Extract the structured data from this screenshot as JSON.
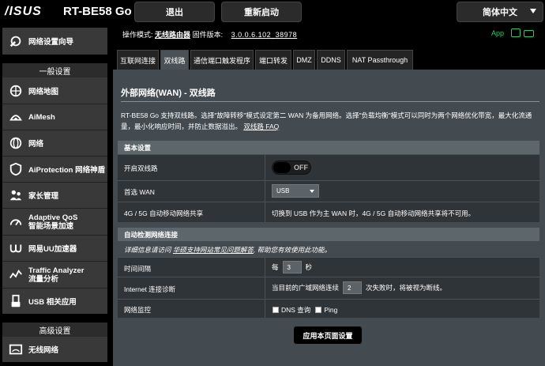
{
  "header": {
    "brand": "/ISUS",
    "model": "RT-BE58 Go",
    "logout_label": "退出",
    "reboot_label": "重新启动",
    "language": "简体中文"
  },
  "status": {
    "mode_label": "操作模式:",
    "mode_value": "无线路由器",
    "fw_label": "固件版本:",
    "fw_value": "3.0.0.6.102_38978",
    "app_label": "App"
  },
  "sidebar": {
    "quick_setup": "网络设置向导",
    "general_header": "一般设置",
    "items": [
      {
        "label": "网络地图",
        "icon": "network-map-icon"
      },
      {
        "label": "AiMesh",
        "icon": "aimesh-icon"
      },
      {
        "label": "网络",
        "icon": "globe-icon"
      },
      {
        "label": "AiProtection 网络神盾",
        "icon": "shield-icon"
      },
      {
        "label": "家长管理",
        "icon": "family-icon"
      },
      {
        "label": "Adaptive QoS",
        "label2": "智能场景加速",
        "icon": "qos-icon"
      },
      {
        "label": "网易UU加速器",
        "icon": "uu-icon"
      },
      {
        "label": "Traffic Analyzer",
        "label2": "流量分析",
        "icon": "traffic-icon"
      },
      {
        "label": "USB 相关应用",
        "icon": "usb-icon"
      }
    ],
    "advanced_header": "高级设置",
    "advanced_items": [
      {
        "label": "无线网络",
        "icon": "wifi-icon"
      }
    ]
  },
  "tabs": [
    "互联网连接",
    "双线路",
    "通信端口触发程序",
    "端口转发",
    "DMZ",
    "DDNS",
    "NAT Passthrough"
  ],
  "main": {
    "title": "外部网络(WAN) - 双线路",
    "description": "RT-BE58 Go 支持双线路。选择\"故障转移\"模式设定第二 WAN 为备用网络。选择\"负载均衡\"模式可以同时为两个网络优化带宽，最大化流通量，最小化响应时间，并防止数据溢出。",
    "faq_link": "双线路 FAQ"
  },
  "basic": {
    "header": "基本设置",
    "dual_wan_label": "开启双线路",
    "dual_wan_state": "OFF",
    "primary_wan_label": "首选 WAN",
    "primary_wan_value": "USB",
    "mobile_share_label": "4G / 5G 自动移动网络共享",
    "mobile_share_value": "切换到 USB 作为主 WAN 时，4G / 5G 自动移动网络共享将不可用。"
  },
  "detect": {
    "header": "自动检测网络连接",
    "info_prefix": "详细信息请访问",
    "info_link": "华硕支持网站常见问题解答",
    "info_suffix": "帮助您有效使用此功能。",
    "interval_label": "时间间隔",
    "interval_prefix": "每",
    "interval_value": "3",
    "interval_unit": "秒",
    "diag_label": "Internet 连接诊断",
    "diag_prefix": "当目前的广域网络连续",
    "diag_value": "2",
    "diag_suffix": "次失败时，将被视为断线。",
    "monitor_label": "网络监控",
    "dns_label": "DNS 查询",
    "ping_label": "Ping"
  },
  "apply_label": "应用本页面设置",
  "colors": {
    "warning": "#ffcc00",
    "accent_green": "#2ecc71"
  }
}
